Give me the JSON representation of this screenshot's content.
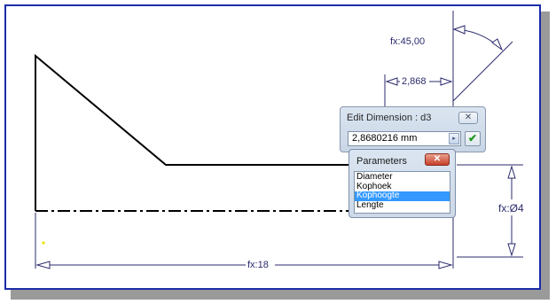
{
  "dimensions": {
    "angle_label": "fx:45,00",
    "top_length_label": "2,868",
    "total_length_label": "fx:18",
    "diameter_label": "fx:Ø4"
  },
  "edit_dialog": {
    "title": "Edit Dimension : d3",
    "value": "2,8680216 mm",
    "close_glyph": "✕",
    "arrow_glyph": "▸",
    "ok_glyph": "✔"
  },
  "parameters_dialog": {
    "title": "Parameters",
    "close_glyph": "✕",
    "items": [
      "Diameter",
      "Kophoek",
      "Kophoogte",
      "Lengte"
    ],
    "selected_index": 2
  },
  "colors": {
    "canvas_border": "#1b2ca8",
    "geometry": "#000000",
    "dimension": "#2b2b6e",
    "selection": "#3399ff"
  }
}
